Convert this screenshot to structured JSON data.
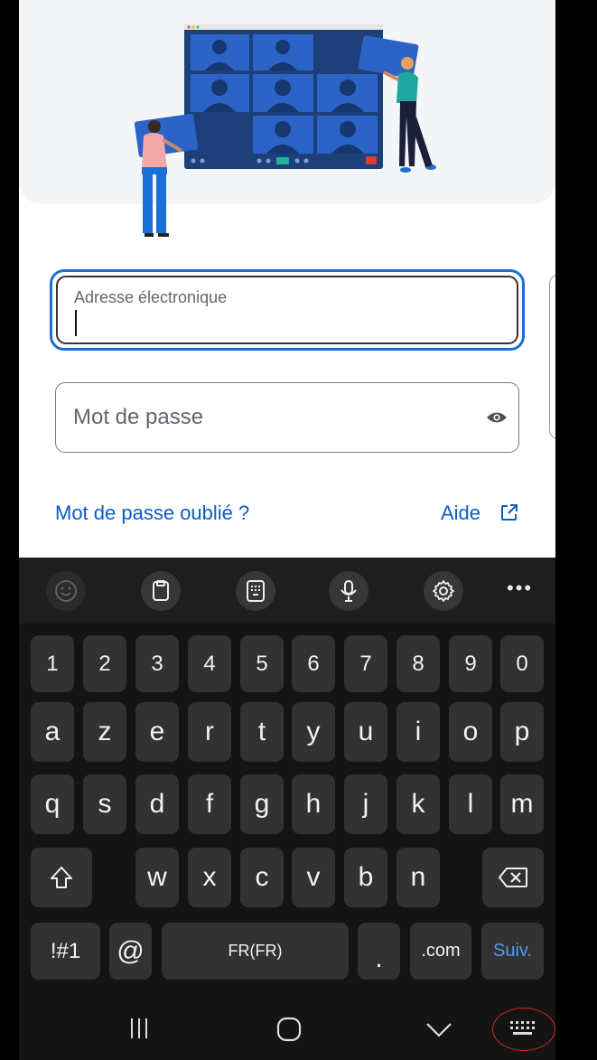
{
  "form": {
    "email_label": "Adresse électronique",
    "password_label": "Mot de passe",
    "forgot_link": "Mot de passe oublié ?",
    "help_link": "Aide"
  },
  "keyboard": {
    "numbers": [
      "1",
      "2",
      "3",
      "4",
      "5",
      "6",
      "7",
      "8",
      "9",
      "0"
    ],
    "row1": [
      "a",
      "z",
      "e",
      "r",
      "t",
      "y",
      "u",
      "i",
      "o",
      "p"
    ],
    "row2": [
      "q",
      "s",
      "d",
      "f",
      "g",
      "h",
      "j",
      "k",
      "l",
      "m"
    ],
    "row3": [
      "w",
      "x",
      "c",
      "v",
      "b",
      "n"
    ],
    "symbols_key": "!#1",
    "at_key": "@",
    "space_key": "FR(FR)",
    "period_key": ".",
    "dotcom_key": ".com",
    "next_key": "Suiv."
  }
}
